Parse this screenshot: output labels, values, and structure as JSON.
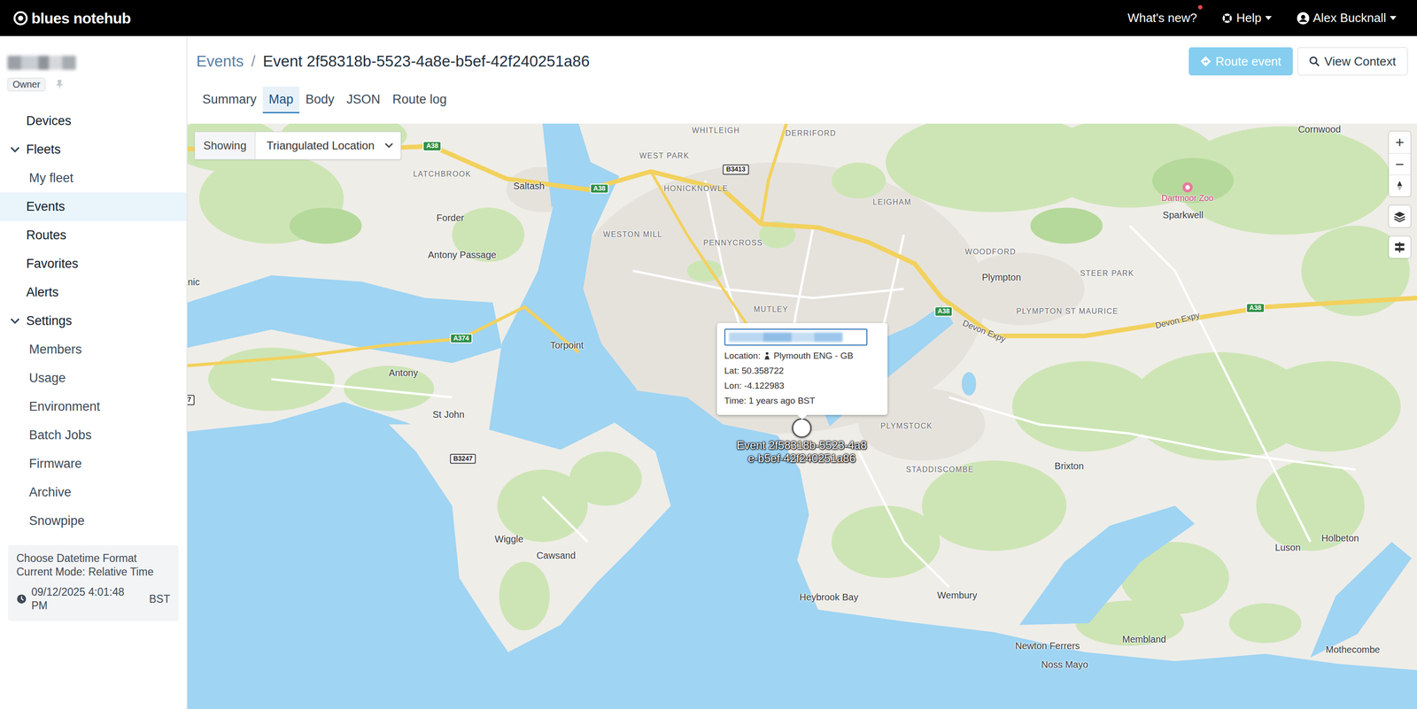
{
  "navbar": {
    "logo": "blues notehub",
    "links": [
      {
        "label": "What's new?",
        "kind": "link",
        "notification": true
      },
      {
        "label": "Help",
        "kind": "menu",
        "notification": false
      }
    ],
    "user": {
      "name": "Alex Bucknall"
    }
  },
  "sidebar": {
    "role": "Owner",
    "items": [
      {
        "label": "Devices",
        "kind": "item",
        "selected": false
      },
      {
        "label": "Fleets",
        "kind": "group",
        "expanded": true,
        "selected": false
      },
      {
        "label": "My fleet",
        "kind": "subitem",
        "selected": false
      },
      {
        "label": "Events",
        "kind": "item",
        "selected": true
      },
      {
        "label": "Routes",
        "kind": "item",
        "selected": false
      },
      {
        "label": "Favorites",
        "kind": "item",
        "selected": false
      },
      {
        "label": "Alerts",
        "kind": "item",
        "selected": false
      },
      {
        "label": "Settings",
        "kind": "group",
        "expanded": true,
        "selected": false
      },
      {
        "label": "Members",
        "kind": "subitem",
        "selected": false
      },
      {
        "label": "Usage",
        "kind": "subitem",
        "selected": false
      },
      {
        "label": "Environment",
        "kind": "subitem",
        "selected": false
      },
      {
        "label": "Batch Jobs",
        "kind": "subitem",
        "selected": false
      },
      {
        "label": "Firmware",
        "kind": "subitem",
        "selected": false
      },
      {
        "label": "Archive",
        "kind": "subitem",
        "selected": false
      },
      {
        "label": "Snowpipe",
        "kind": "subitem",
        "selected": false
      }
    ],
    "datetime": {
      "title": "Choose Datetime Format",
      "mode": "Current Mode: Relative Time",
      "value": "09/12/2025 4:01:48 PM",
      "zone": "BST"
    }
  },
  "breadcrumb": {
    "parent": "Events",
    "separator": "/",
    "current": "Event 2f58318b-5523-4a8e-b5ef-42f240251a86"
  },
  "actions": [
    {
      "label": "Route event",
      "disabled": true
    },
    {
      "label": "View Context",
      "disabled": false
    }
  ],
  "tabs": [
    {
      "label": "Summary",
      "selected": false
    },
    {
      "label": "Map",
      "selected": true
    },
    {
      "label": "Body",
      "selected": false
    },
    {
      "label": "JSON",
      "selected": false
    },
    {
      "label": "Route log",
      "selected": false
    }
  ],
  "map": {
    "showing": "Showing",
    "layer": "Triangulated Location",
    "zoom": [
      "+",
      "−"
    ],
    "places": [
      {
        "label": "WHITLEIGH",
        "kind": "suburb"
      },
      {
        "label": "DERRIFORD",
        "kind": "suburb"
      },
      {
        "label": "WEST PARK",
        "kind": "suburb"
      },
      {
        "label": "LATCHBROOK",
        "kind": "suburb"
      },
      {
        "label": "Saltash",
        "kind": "town"
      },
      {
        "label": "HONICKNOWLE",
        "kind": "suburb"
      },
      {
        "label": "LEIGHAM",
        "kind": "suburb"
      },
      {
        "label": "Forder",
        "kind": "town"
      },
      {
        "label": "WESTON MILL",
        "kind": "suburb"
      },
      {
        "label": "PENNYCROSS",
        "kind": "suburb"
      },
      {
        "label": "Antony Passage",
        "kind": "town"
      },
      {
        "label": "WOODFORD",
        "kind": "suburb"
      },
      {
        "label": "Plympton",
        "kind": "town"
      },
      {
        "label": "STEER PARK",
        "kind": "suburb"
      },
      {
        "label": "PLYMPTON ST MAURICE",
        "kind": "suburb"
      },
      {
        "label": "MUTLEY",
        "kind": "suburb"
      },
      {
        "label": "Torpoint",
        "kind": "town"
      },
      {
        "label": "Antony",
        "kind": "town"
      },
      {
        "label": "St John",
        "kind": "town"
      },
      {
        "label": "PLYMSTOCK",
        "kind": "suburb"
      },
      {
        "label": "STADDISCOMBE",
        "kind": "suburb"
      },
      {
        "label": "Brixton",
        "kind": "town"
      },
      {
        "label": "Wiggle",
        "kind": "town"
      },
      {
        "label": "Cawsand",
        "kind": "town"
      },
      {
        "label": "Heybrook Bay",
        "kind": "town"
      },
      {
        "label": "Wembury",
        "kind": "town"
      },
      {
        "label": "Newton Ferrers",
        "kind": "town"
      },
      {
        "label": "Noss Mayo",
        "kind": "town"
      },
      {
        "label": "Membland",
        "kind": "town"
      },
      {
        "label": "Luson",
        "kind": "town"
      },
      {
        "label": "Holbeton",
        "kind": "town"
      },
      {
        "label": "Mothecombe",
        "kind": "town"
      },
      {
        "label": "Sparkwell",
        "kind": "town"
      },
      {
        "label": "Cornwood",
        "kind": "town"
      },
      {
        "label": "Dartmoor Zoo",
        "kind": "poi"
      },
      {
        "label": "nic",
        "kind": "town"
      },
      {
        "label": "A38",
        "kind": "shield-green"
      },
      {
        "label": "A38",
        "kind": "shield-green"
      },
      {
        "label": "B3413",
        "kind": "shield-white"
      },
      {
        "label": "A374",
        "kind": "shield-green"
      },
      {
        "label": "B3247",
        "kind": "shield-white"
      },
      {
        "label": "A38",
        "kind": "shield-green"
      },
      {
        "label": "A38",
        "kind": "shield-green"
      },
      {
        "label": "7",
        "kind": "shield-white"
      },
      {
        "label": "Devon Expy",
        "kind": "road"
      },
      {
        "label": "Devon Expy",
        "kind": "road"
      }
    ],
    "pin_label": "Event 2f58318b-5523-4a8e-b5ef-42f240251a86",
    "popup": {
      "location": "Location:",
      "city": "Plymouth ENG - GB",
      "lat": "Lat: 50.358722",
      "lon": "Lon: -4.122983",
      "time": "Time: 1 years ago BST"
    }
  }
}
